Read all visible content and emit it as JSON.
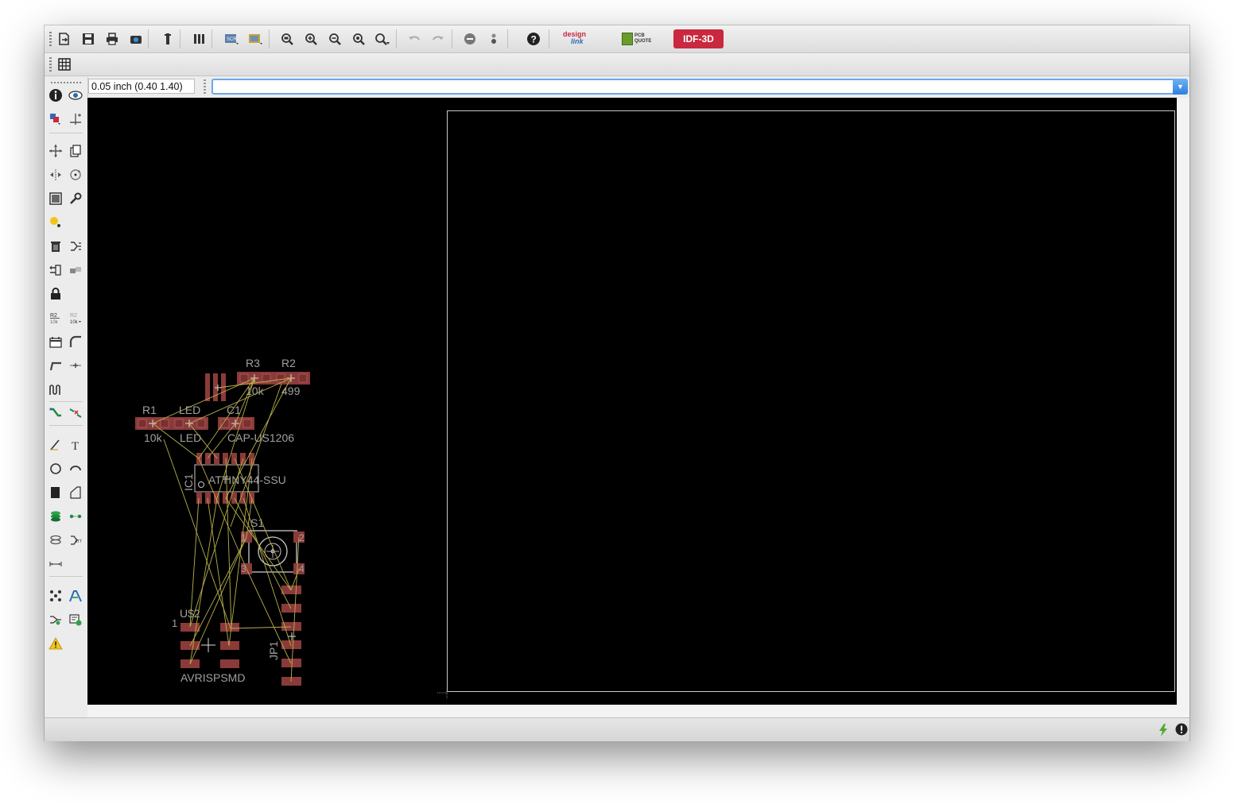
{
  "command_bar": {
    "coordinate_readout": "0.05 inch (0.40 1.40)",
    "command_value": ""
  },
  "toolbar": {
    "idf_label": "IDF-3D",
    "designlink_top": "design",
    "designlink_bottom": "link",
    "pcbquote_top": "PCB",
    "pcbquote_bottom": "QUOTE"
  },
  "board": {
    "components": {
      "r3_name": "R3",
      "r3_value": "10k",
      "r2_name": "R2",
      "r2_value": "499",
      "r1_name": "R1",
      "r1_value": "10k",
      "led_name": "LED",
      "led_value": "LED",
      "c1_name": "C1",
      "c1_value": "CAP-US1206",
      "ic_name": "IC1",
      "ic_value": "ATTINY44-SSU",
      "s1_name": "S1",
      "s1_pin1": "1",
      "s1_pin2": "2",
      "s1_pin3": "3",
      "s1_pin4": "4",
      "usb_name": "U$2",
      "usb_pin1": "1",
      "usb_value": "AVRISPSMD",
      "jp_name": "JP1"
    }
  },
  "colors": {
    "canvas": "#000000",
    "pad": "#8b3a3a",
    "airwire": "#b8b04a",
    "outline": "#c8c8c8",
    "accent": "#c9283e",
    "focus": "#6ea7ea"
  }
}
